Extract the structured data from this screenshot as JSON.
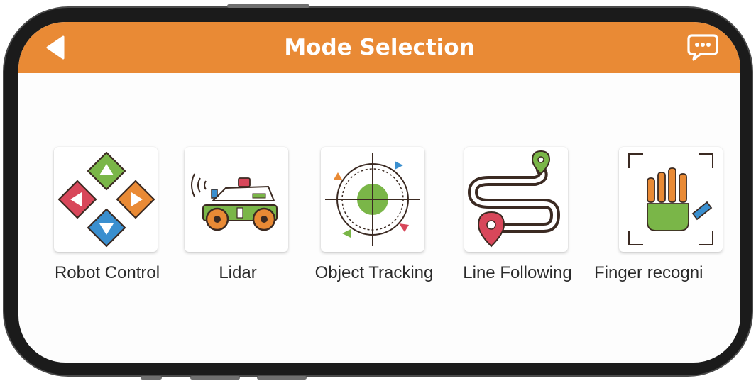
{
  "header": {
    "title": "Mode Selection",
    "back_icon": "back-arrow-icon",
    "chat_icon": "chat-bubble-icon",
    "color": "#e98a35"
  },
  "modes": [
    {
      "label": "Robot Control",
      "icon": "direction-pad-icon"
    },
    {
      "label": "Lidar",
      "icon": "lidar-car-icon"
    },
    {
      "label": "Object Tracking",
      "icon": "target-crosshair-icon"
    },
    {
      "label": "Line Following",
      "icon": "path-pin-icon"
    },
    {
      "label": "Finger recogni",
      "icon": "hand-scan-icon"
    }
  ]
}
